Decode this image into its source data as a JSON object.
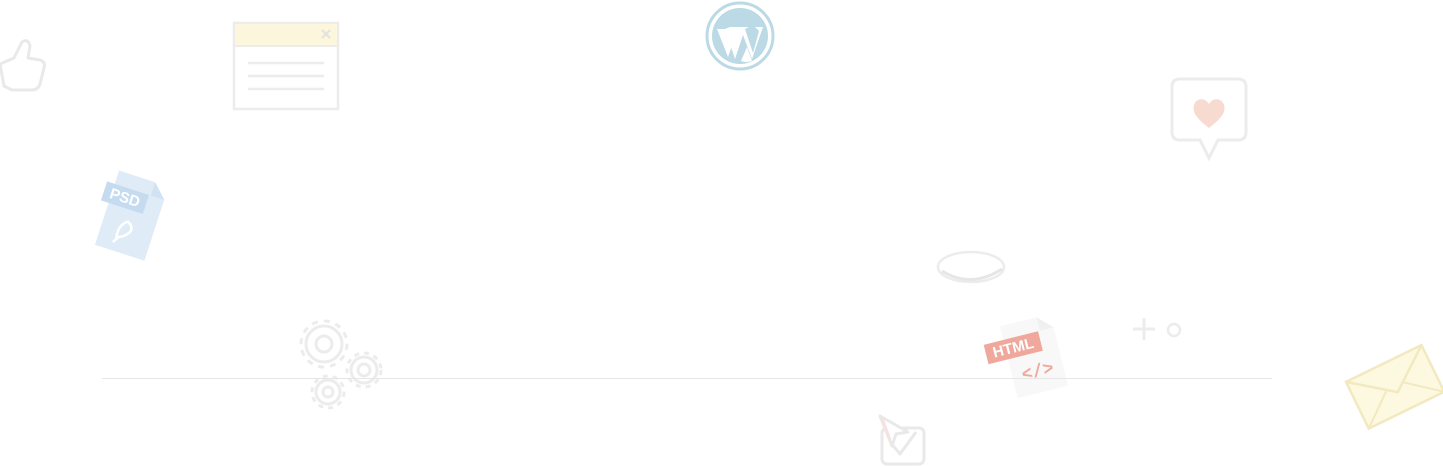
{
  "page": {
    "background": "#ffffff",
    "divider_color": "#e6e6e6"
  },
  "icons": [
    {
      "name": "thumbs-up-icon"
    },
    {
      "name": "browser-window-icon"
    },
    {
      "name": "wordpress-logo-icon"
    },
    {
      "name": "heart-speech-bubble-icon"
    },
    {
      "name": "psd-file-icon",
      "label": "PSD"
    },
    {
      "name": "cloud-pebble-icon"
    },
    {
      "name": "html-file-icon",
      "label": "HTML",
      "code": "</>"
    },
    {
      "name": "plus-circle-decoration-icon"
    },
    {
      "name": "gears-icon"
    },
    {
      "name": "checkbox-cursor-icon"
    },
    {
      "name": "envelope-icon"
    }
  ],
  "colors": {
    "outline": "#e9e9e9",
    "wordpress_blue": "#2f8fb4",
    "psd_blue": "#7fb0e0",
    "html_red": "#e0533a",
    "heart_pink": "#f0b8a8",
    "envelope_yellow": "#f2e08a",
    "window_top": "#fbf6dc"
  }
}
